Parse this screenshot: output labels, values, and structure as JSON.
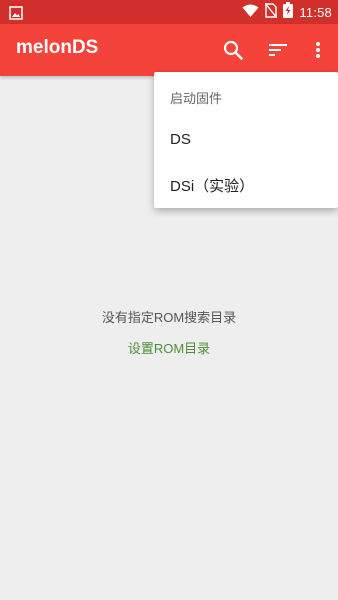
{
  "status_bar": {
    "time": "11:58",
    "icons": [
      "image-notification-icon",
      "wifi-icon",
      "no-sim-icon",
      "battery-charging-icon"
    ]
  },
  "app_bar": {
    "title": "melonDS",
    "actions": [
      "search-icon",
      "sort-icon",
      "more-vert-icon"
    ],
    "color": "#f4433a"
  },
  "menu": {
    "header": "启动固件",
    "items": [
      {
        "label": "DS"
      },
      {
        "label": "DSi（实验）"
      }
    ]
  },
  "empty_state": {
    "message": "没有指定ROM搜索目录",
    "link": "设置ROM目录",
    "link_color": "#4e8f3a"
  }
}
